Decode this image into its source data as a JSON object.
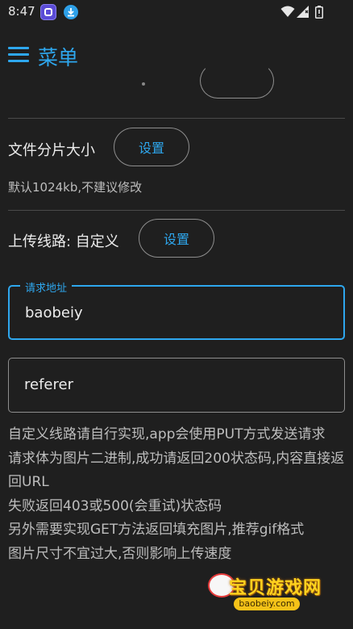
{
  "status_bar": {
    "time": "8:47"
  },
  "header": {
    "title": "菜单"
  },
  "settings": {
    "chunk_size": {
      "label": "文件分片大小",
      "button": "设置",
      "hint": "默认1024kb,不建议修改"
    },
    "upload_route": {
      "label": "上传线路: 自定义",
      "button": "设置"
    }
  },
  "form": {
    "request_url": {
      "label": "请求地址",
      "value": "baobeiy"
    },
    "referer": {
      "value": "referer"
    }
  },
  "description": [
    "自定义线路请自行实现,app会使用PUT方式发送请求",
    "请求体为图片二进制,成功请返回200状态码,内容直接返回URL",
    "失败返回403或500(会重试)状态码",
    "另外需要实现GET方法返回填充图片,推荐gif格式",
    "图片尺寸不宜过大,否则影响上传速度"
  ],
  "watermark": {
    "text": "宝贝游戏网",
    "url": "baobeiy.com"
  },
  "colors": {
    "accent": "#2ea7ee",
    "background": "#1f1f1f"
  }
}
